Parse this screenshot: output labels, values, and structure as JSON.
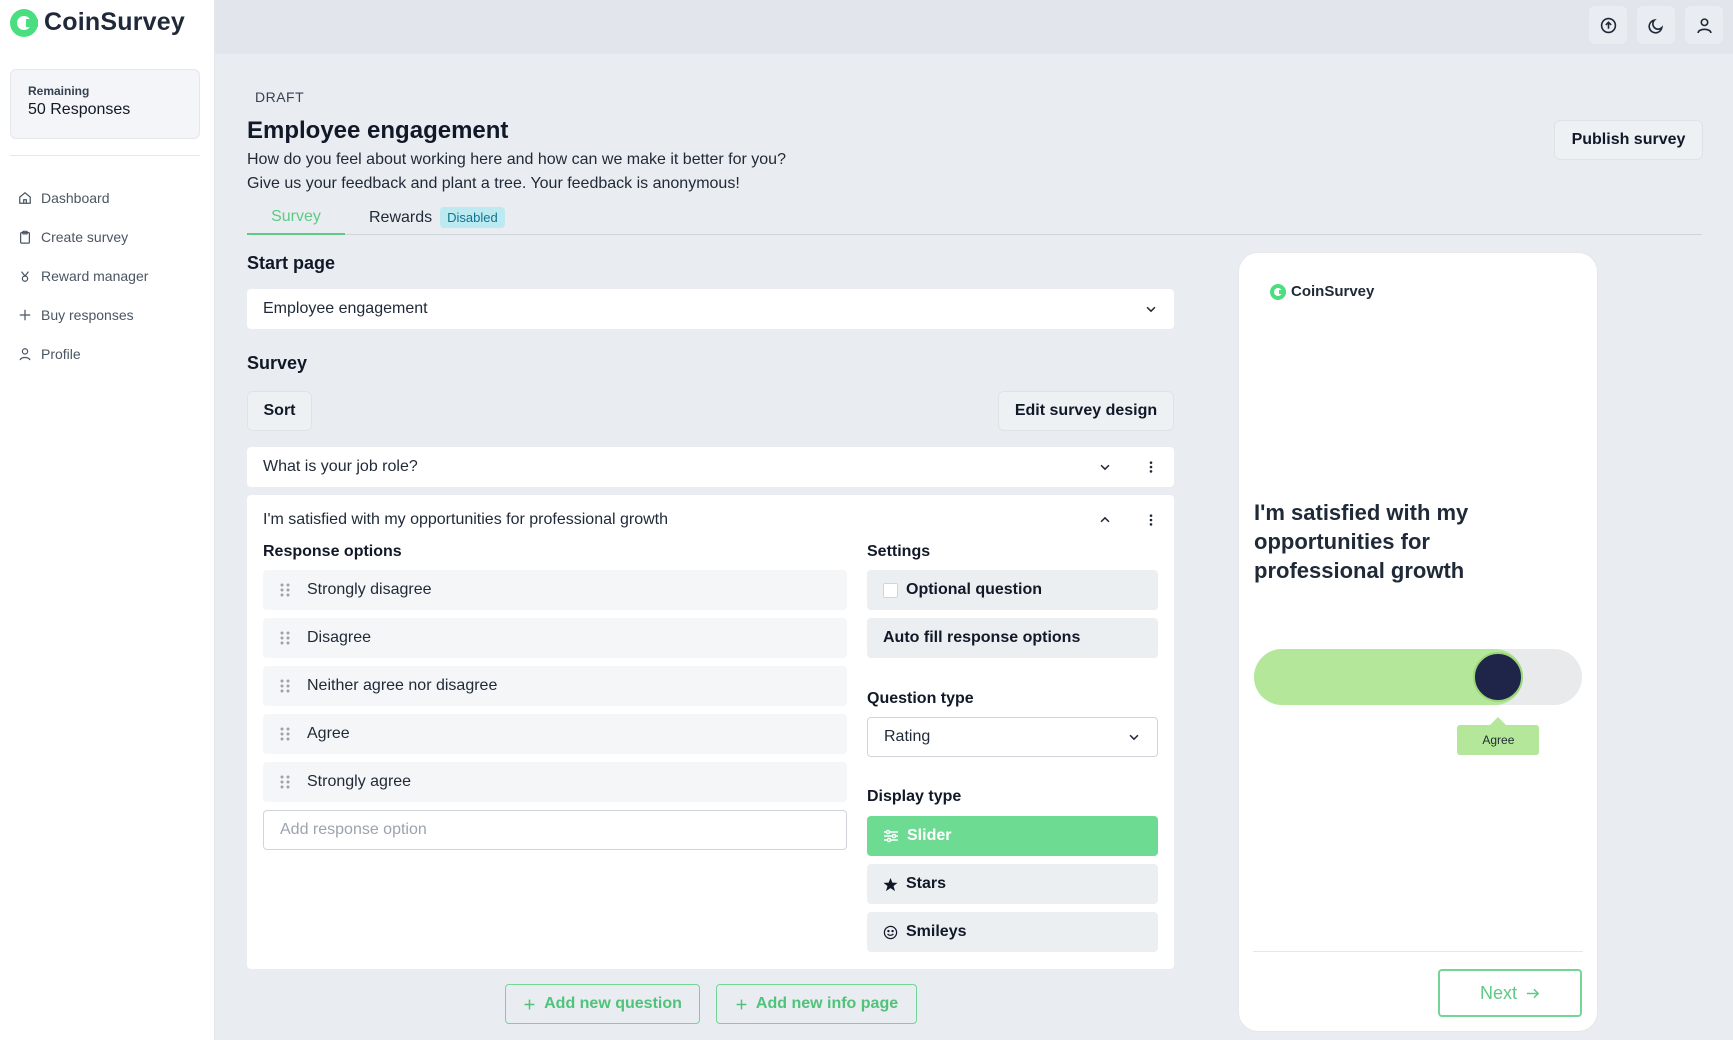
{
  "app": {
    "name": "CoinSurvey"
  },
  "sidebar": {
    "remaining_label": "Remaining",
    "remaining_value": "50 Responses",
    "items": [
      {
        "label": "Dashboard",
        "icon": "home-icon"
      },
      {
        "label": "Create survey",
        "icon": "clipboard-icon"
      },
      {
        "label": "Reward manager",
        "icon": "gift-icon"
      },
      {
        "label": "Buy responses",
        "icon": "plus-icon"
      },
      {
        "label": "Profile",
        "icon": "user-icon"
      }
    ]
  },
  "topbar": {
    "icons": [
      "arrow-up-circle-icon",
      "moon-icon",
      "user-icon"
    ]
  },
  "header": {
    "status": "DRAFT",
    "title": "Employee engagement",
    "description_line1": "How do you feel about working here and how can we make it better for you?",
    "description_line2": "Give us your feedback and plant a tree. Your feedback is anonymous!",
    "publish_label": "Publish survey"
  },
  "tabs": {
    "survey": "Survey",
    "rewards": "Rewards",
    "rewards_badge": "Disabled"
  },
  "start_page": {
    "title": "Start page",
    "selected": "Employee engagement"
  },
  "survey": {
    "title": "Survey",
    "sort_label": "Sort",
    "edit_design_label": "Edit survey design",
    "questions": [
      {
        "text": "What is your job role?"
      },
      {
        "text": "I'm satisfied with my opportunities for professional growth"
      }
    ],
    "response_options_title": "Response options",
    "options": [
      "Strongly disagree",
      "Disagree",
      "Neither agree nor disagree",
      "Agree",
      "Strongly agree"
    ],
    "add_option_placeholder": "Add response option",
    "settings_title": "Settings",
    "optional_label": "Optional question",
    "autofill_label": "Auto fill response options",
    "question_type_title": "Question type",
    "question_type_value": "Rating",
    "display_type_title": "Display type",
    "display_types": [
      {
        "label": "Slider",
        "icon": "sliders-icon",
        "active": true
      },
      {
        "label": "Stars",
        "icon": "star-icon",
        "active": false
      },
      {
        "label": "Smileys",
        "icon": "smiley-icon",
        "active": false
      }
    ],
    "add_question_label": "Add new question",
    "add_info_page_label": "Add new info page"
  },
  "preview": {
    "brand": "CoinSurvey",
    "question": "I'm satisfied with my opportunities for professional growth",
    "slider_value_label": "Agree",
    "slider_fraction": 0.745,
    "next_label": "Next"
  },
  "colors": {
    "accent": "#5fc985",
    "accent_light": "#b4e79a",
    "knob": "#1e2548",
    "badge_bg": "#bde9f0"
  }
}
